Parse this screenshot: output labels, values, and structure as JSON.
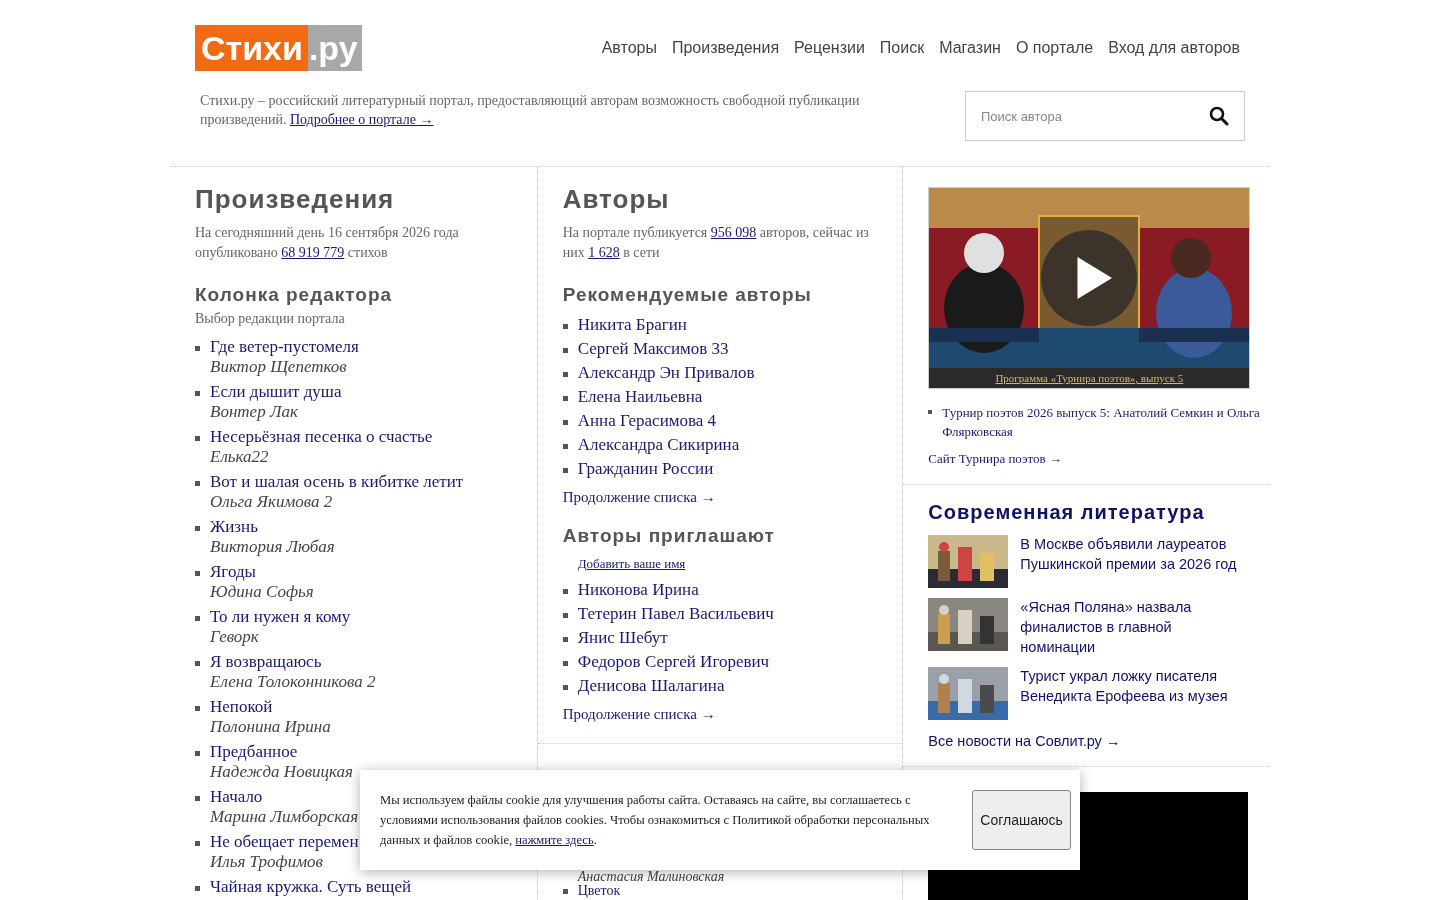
{
  "logo": {
    "main": "Стихи",
    "suffix": ".ру"
  },
  "nav": [
    "Авторы",
    "Произведения",
    "Рецензии",
    "Поиск",
    "Магазин",
    "О портале",
    "Вход для авторов"
  ],
  "intro": {
    "text": "Стихи.ру – российский литературный портал, предоставляющий авторам возможность свободной публикации произведений.",
    "link": "Подробнее о портале →"
  },
  "search": {
    "placeholder": "Поиск автора"
  },
  "works": {
    "title": "Произведения",
    "stat_before": "На сегодняшний день 16 сентября 2026 года опубликовано",
    "stat_count": "68 919 779",
    "stat_after": "стихов",
    "editor_title": "Колонка редактора",
    "editor_sub": "Выбор редакции портала",
    "items": [
      {
        "title": "Где ветер-пустомеля",
        "author": "Виктор Щепетков"
      },
      {
        "title": "Если дышит душа",
        "author": "Вонтер Лак"
      },
      {
        "title": "Несерьёзная песенка о счастье",
        "author": "Елька22"
      },
      {
        "title": "Вот и шалая осень в кибитке летит",
        "author": "Ольга Якимова 2"
      },
      {
        "title": "Жизнь",
        "author": "Виктория Любая"
      },
      {
        "title": "Ягоды",
        "author": "Юдина Софья"
      },
      {
        "title": "То ли нужен я кому",
        "author": "Геворк"
      },
      {
        "title": "Я возвращаюсь",
        "author": "Елена Толоконникова 2"
      },
      {
        "title": "Непокой",
        "author": "Полонина Ирина"
      },
      {
        "title": "Предбанное",
        "author": "Надежда Новицкая"
      },
      {
        "title": "Начало",
        "author": "Марина Лимборская"
      },
      {
        "title": "Не обещает перемен",
        "author": "Илья Трофимов"
      },
      {
        "title": "Чайная кружка. Суть вещей"
      }
    ]
  },
  "authors": {
    "title": "Авторы",
    "stat_before": "На портале публикуется",
    "stat_count": "956 098",
    "stat_mid": "авторов, сейчас из них",
    "stat_online": "1 628",
    "stat_after": "в сети",
    "recommended_title": "Рекомендуемые авторы",
    "recommended": [
      "Никита Брагин",
      "Сергей Максимов 33",
      "Александр Эн Привалов",
      "Елена Наильевна",
      "Анна Герасимова 4",
      "Александра Сикирина",
      "Гражданин России"
    ],
    "more": "Продолжение списка →",
    "invite_title": "Авторы приглашают",
    "add_name": "Добавить ваше имя",
    "invite": [
      "Никонова Ирина",
      "Тетерин Павел Васильевич",
      "Янис Шебут",
      "Федоров Сергей Игоревич",
      "Денисова Шалагина"
    ],
    "more2": "Продолжение списка →",
    "lower_author": "Анастасия Малиновская",
    "lower_item": "Цветок"
  },
  "video": {
    "caption": "Программа «Турнира поэтов», выпуск 5",
    "item": "Турнир поэтов 2026 выпуск 5: Анатолий Семкин и Ольга Флярковская",
    "site": "Сайт Турнира поэтов →"
  },
  "news": {
    "title": "Современная литература",
    "items": [
      {
        "kind": "picture",
        "text": "В Москве объявили лауреатов Пушкинской премии за 2026 год"
      },
      {
        "kind": "picture",
        "text": "«Ясная Поляна» назвала финалистов в главной номинации"
      },
      {
        "kind": "picture",
        "text": "Турист украл ложку писателя Венедикта Ерофеева из музея"
      }
    ],
    "all": "Все новости на Совлит.ру →"
  },
  "cookie": {
    "text": "Мы используем файлы cookie для улучшения работы сайта. Оставаясь на сайте, вы соглашаетесь с условиями использования файлов cookies. Чтобы ознакомиться с Политикой обработки персональных данных и файлов cookie,",
    "link": "нажмите здесь",
    "end": ".",
    "button": "Соглашаюсь"
  }
}
